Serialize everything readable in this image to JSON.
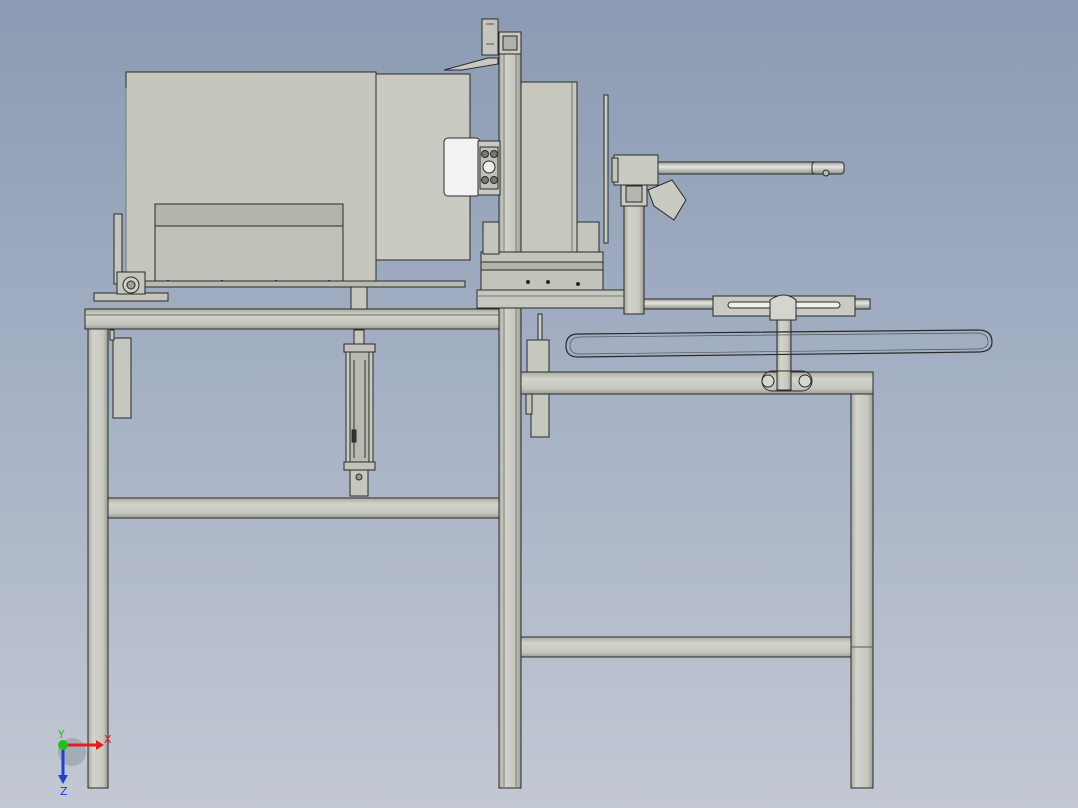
{
  "view": {
    "colors": {
      "background_top": "#8b9bb3",
      "background_bottom": "#c3c8d3",
      "part_fill": "#c2c3bb",
      "edge": "#2a2a2a"
    }
  },
  "triad": {
    "x_label": "X",
    "y_label": "Y",
    "z_label": "Z",
    "x_color": "#e02020",
    "y_color": "#20c020",
    "z_color": "#2040d0"
  }
}
